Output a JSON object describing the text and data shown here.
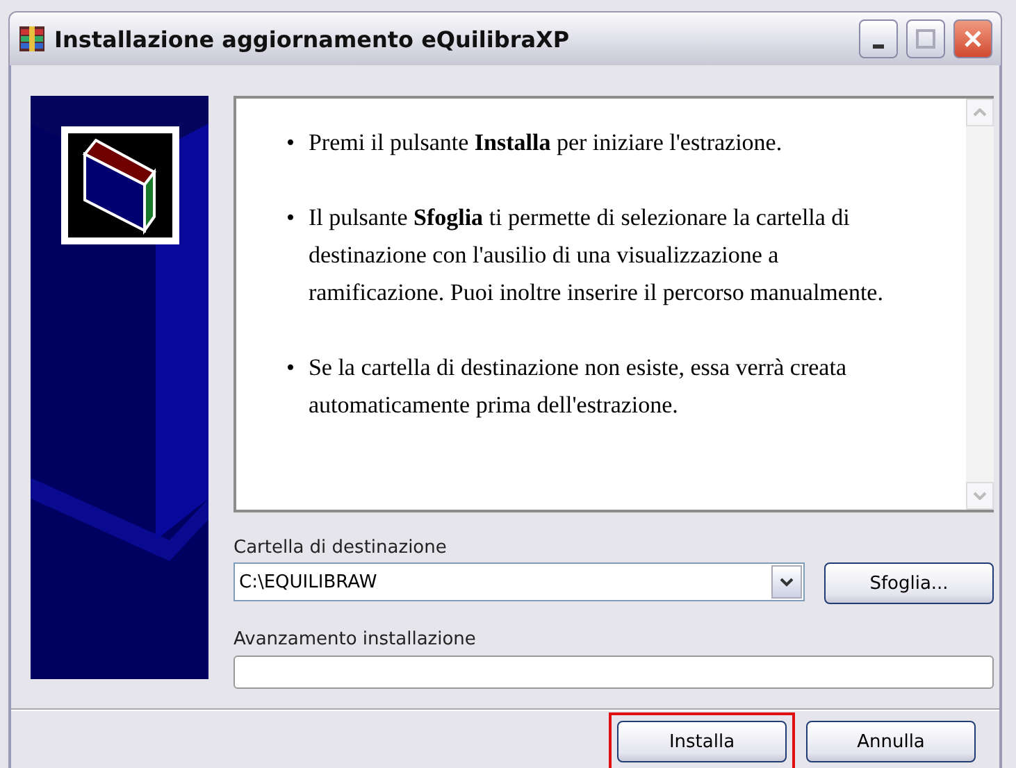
{
  "window": {
    "title": "Installazione aggiornamento eQuilibraXP"
  },
  "instructions": [
    {
      "bullet": "•",
      "text": "Premi il pulsante **Installa** per iniziare l'estrazione."
    },
    {
      "bullet": "•",
      "text": "Il pulsante **Sfoglia** ti permette di selezionare la cartella di destinazione con l'ausilio di una visualizzazione a ramificazione. Puoi inoltre inserire il percorso manualmente."
    },
    {
      "bullet": "•",
      "text": "Se la cartella di destinazione non esiste, essa verrà creata automaticamente prima dell'estrazione."
    }
  ],
  "destination": {
    "label": "Cartella di destinazione",
    "value": "C:\\EQUILIBRAW",
    "browse_button": "Sfoglia..."
  },
  "progress": {
    "label": "Avanzamento installazione",
    "level": 0
  },
  "buttons": [
    {
      "label": "Installa",
      "highlighted": true
    },
    {
      "label": "Annulla",
      "highlighted": false
    }
  ]
}
